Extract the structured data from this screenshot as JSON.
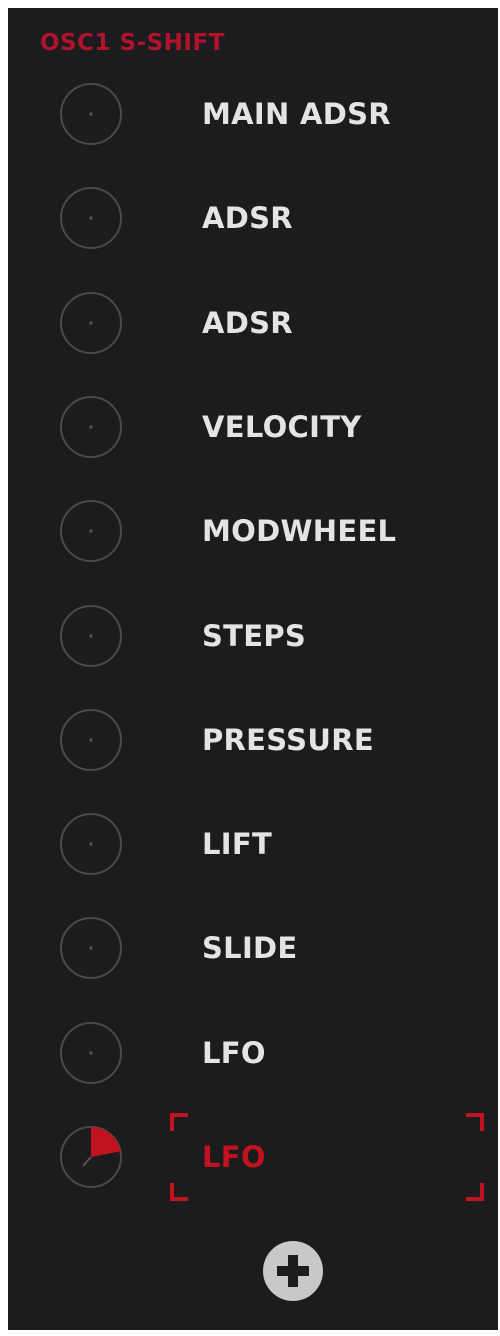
{
  "panel": {
    "title": "OSC1 S-SHIFT"
  },
  "sources": [
    {
      "label": "MAIN ADSR",
      "amount": 0
    },
    {
      "label": "ADSR",
      "amount": 0
    },
    {
      "label": "ADSR",
      "amount": 0
    },
    {
      "label": "VELOCITY",
      "amount": 0
    },
    {
      "label": "MODWHEEL",
      "amount": 0
    },
    {
      "label": "STEPS",
      "amount": 0
    },
    {
      "label": "PRESSURE",
      "amount": 0
    },
    {
      "label": "LIFT",
      "amount": 0
    },
    {
      "label": "SLIDE",
      "amount": 0
    },
    {
      "label": "LFO",
      "amount": 0
    },
    {
      "label": "LFO",
      "amount": 0.22,
      "selected": true
    }
  ],
  "add_button": {
    "icon": "plus-icon"
  },
  "colors": {
    "accent": "#c1121f",
    "background": "#1c1c1e",
    "label": "#e4e4e6",
    "knob_ring": "#4a4a4d"
  }
}
